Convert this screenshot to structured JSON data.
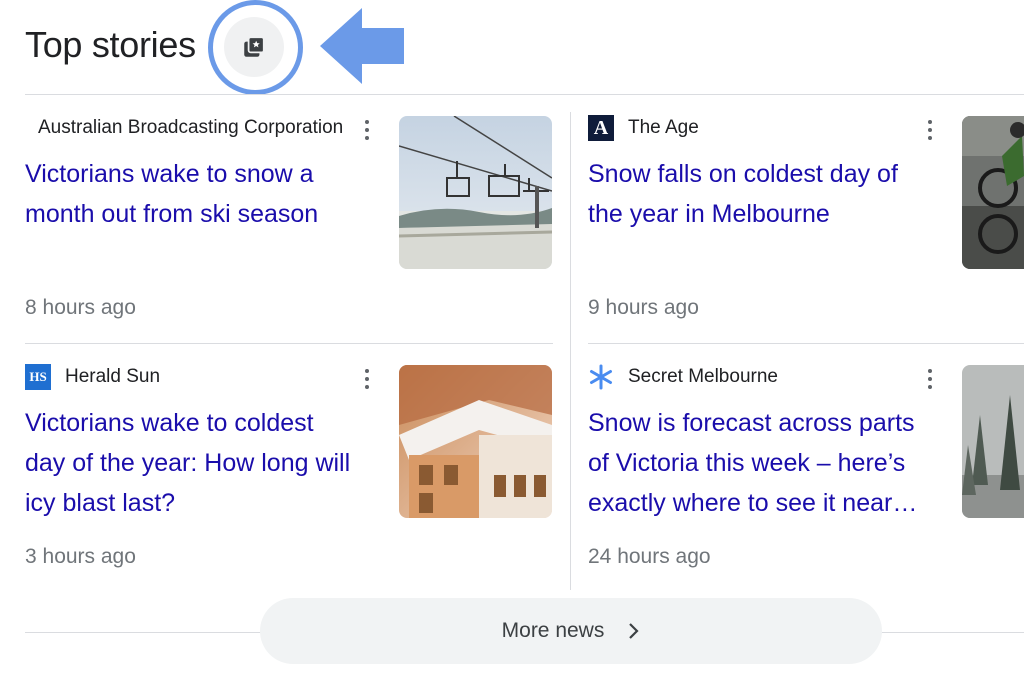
{
  "header": {
    "title": "Top stories"
  },
  "stories": [
    {
      "source": "Australian Broadcasting Corporation",
      "headline_lines": [
        "Victorians wake to snow a",
        "month out from ski season"
      ],
      "age": "8 hours ago"
    },
    {
      "source": "The Age",
      "source_logo_letter": "A",
      "headline_lines": [
        "Snow falls on coldest day of",
        "the year in Melbourne"
      ],
      "age": "9 hours ago"
    },
    {
      "source": "Herald Sun",
      "source_logo_letter": "HS",
      "headline_lines": [
        "Victorians wake to coldest",
        "day of the year: How long will",
        "icy blast last?"
      ],
      "age": "3 hours ago"
    },
    {
      "source": "Secret Melbourne",
      "headline_lines": [
        "Snow is forecast across parts",
        "of Victoria this week – here’s",
        "exactly where to see it near…"
      ],
      "age": "24 hours ago"
    }
  ],
  "footer": {
    "more_label": "More news"
  },
  "icons": {
    "header_button": "stacked-news-star-icon",
    "menu": "more-vert-icon",
    "more": "chevron-right-icon",
    "secret_melbourne_logo": "asterisk-icon"
  },
  "colors": {
    "link": "#1a0dab",
    "highlight": "#6b9ae8"
  }
}
